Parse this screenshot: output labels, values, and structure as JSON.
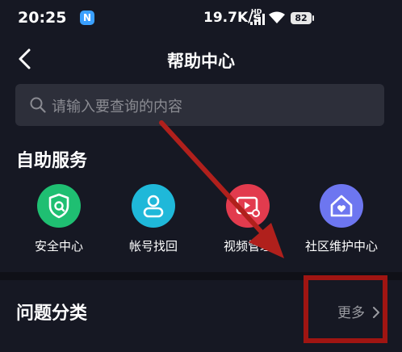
{
  "status_bar": {
    "time": "20:25",
    "app_badge": "N",
    "net_speed": "19.7K/s",
    "hd_label": "HD",
    "battery": "82"
  },
  "header": {
    "title": "帮助中心",
    "back_icon": "chevron-left-icon"
  },
  "search": {
    "placeholder": "请输入要查询的内容",
    "icon": "search-icon"
  },
  "self_service": {
    "title": "自助服务",
    "items": [
      {
        "label": "安全中心",
        "icon": "shield-icon",
        "color": "#1fbf72"
      },
      {
        "label": "帐号找回",
        "icon": "user-icon",
        "color": "#1fb8d9"
      },
      {
        "label": "视频管理",
        "icon": "video-settings-icon",
        "color": "#e23b4e"
      },
      {
        "label": "社区维护中心",
        "icon": "home-heart-icon",
        "color": "#6d76f0"
      }
    ]
  },
  "categories": {
    "title": "问题分类",
    "more_label": "更多"
  },
  "annotations": {
    "arrow_color": "#b0201c",
    "box_color": "#a01512"
  }
}
